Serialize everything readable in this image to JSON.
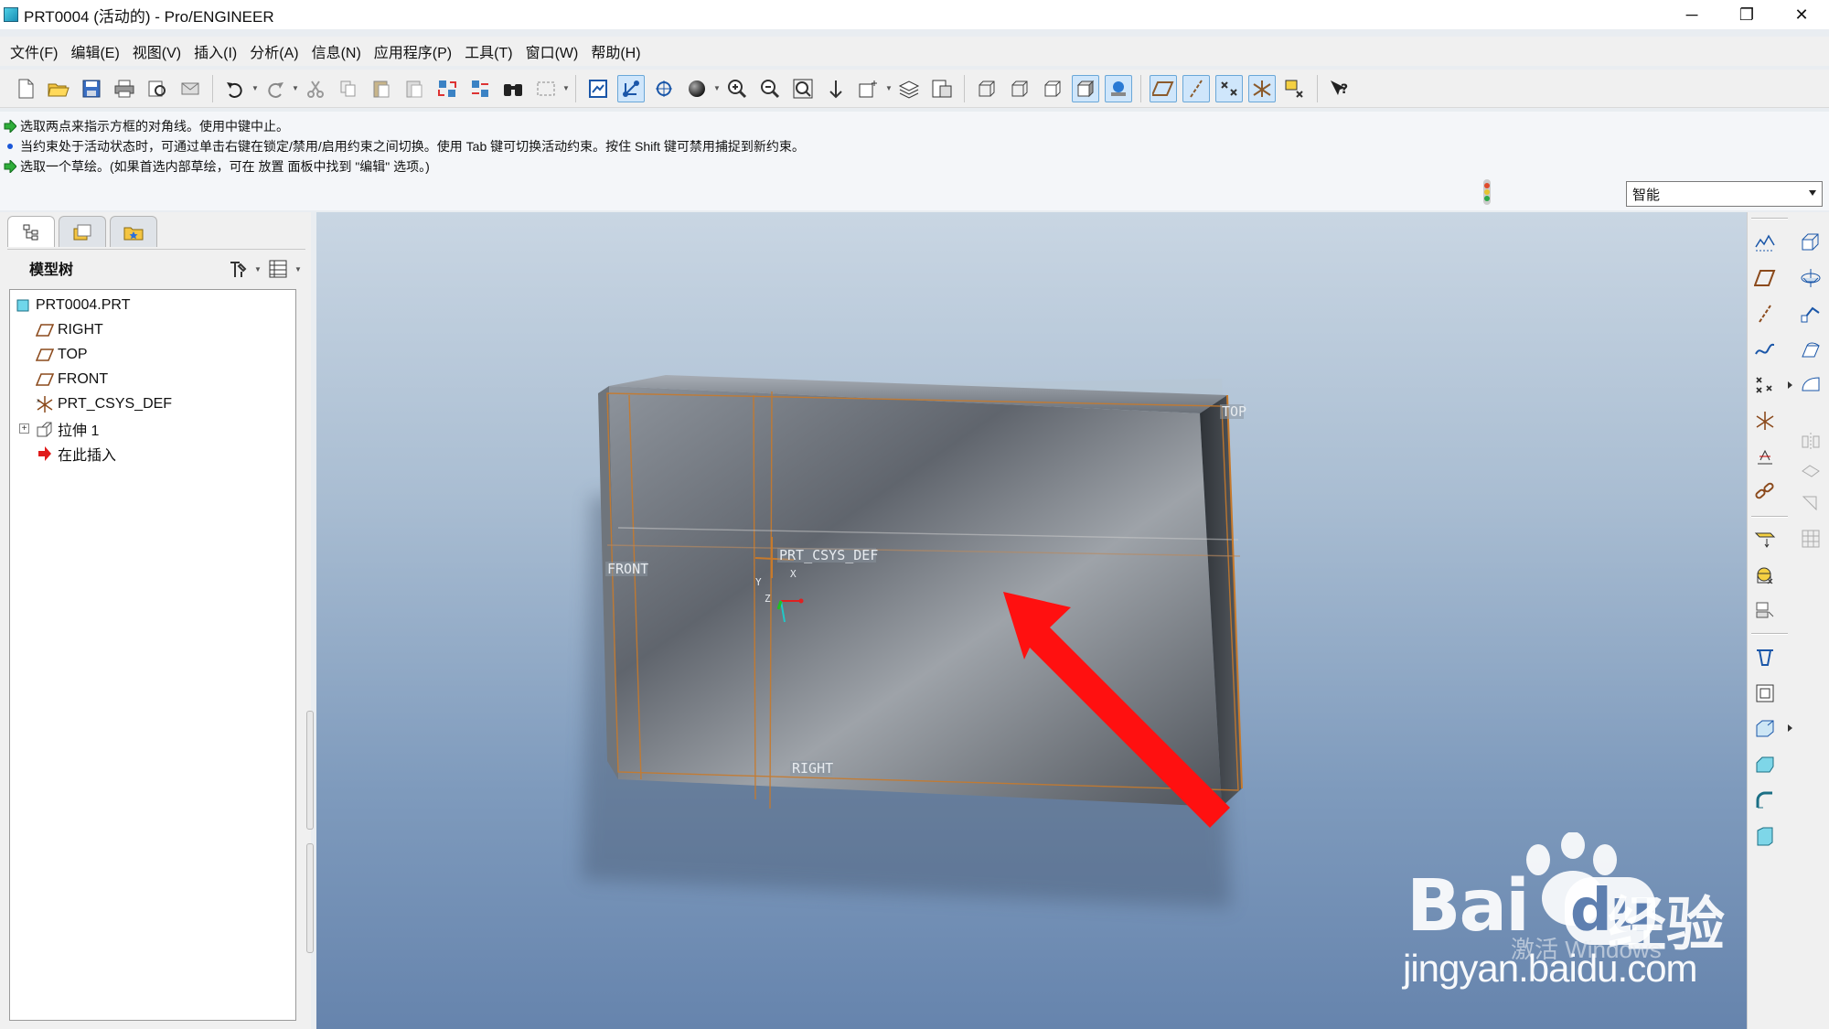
{
  "window": {
    "title": "PRT0004 (活动的) - Pro/ENGINEER",
    "buttons": [
      "─",
      "❐",
      "✕"
    ]
  },
  "menu": [
    "文件(F)",
    "编辑(E)",
    "视图(V)",
    "插入(I)",
    "分析(A)",
    "信息(N)",
    "应用程序(P)",
    "工具(T)",
    "窗口(W)",
    "帮助(H)"
  ],
  "messages": [
    "选取两点来指示方框的对角线。使用中键中止。",
    "当约束处于活动状态时，可通过单击右键在锁定/禁用/启用约束之间切换。使用 Tab 键可切换活动约束。按住 Shift 键可禁用捕捉到新约束。",
    "选取一个草绘。(如果首选内部草绘，可在 放置 面板中找到 \"编辑\" 选项。)"
  ],
  "filter": {
    "selected": "智能"
  },
  "model_tree": {
    "title": "模型树",
    "items": [
      {
        "label": "PRT0004.PRT",
        "icon": "part-icon"
      },
      {
        "label": "RIGHT",
        "icon": "datum-plane-icon"
      },
      {
        "label": "TOP",
        "icon": "datum-plane-icon"
      },
      {
        "label": "FRONT",
        "icon": "datum-plane-icon"
      },
      {
        "label": "PRT_CSYS_DEF",
        "icon": "csys-icon"
      },
      {
        "label": "拉伸 1",
        "icon": "extrude-icon"
      },
      {
        "label": "在此插入",
        "icon": "insert-here-arrow-icon"
      }
    ]
  },
  "viewport": {
    "datum_labels": {
      "top": "TOP",
      "front": "FRONT",
      "right": "RIGHT",
      "csys": "PRT_CSYS_DEF",
      "csys_axis_x": "X",
      "csys_axis_y": "Y",
      "csys_axis_z": "Z"
    },
    "annotation_arrow_color": "#ff1010",
    "datum_color": "#c77a2c",
    "background_top": "#c9d6e3",
    "background_bottom": "#6684ad"
  },
  "watermark": {
    "brand": "Bai",
    "brand_suffix": "du",
    "cn": "经验",
    "os": "激活 Windows",
    "url": "jingyan.baidu.com"
  }
}
